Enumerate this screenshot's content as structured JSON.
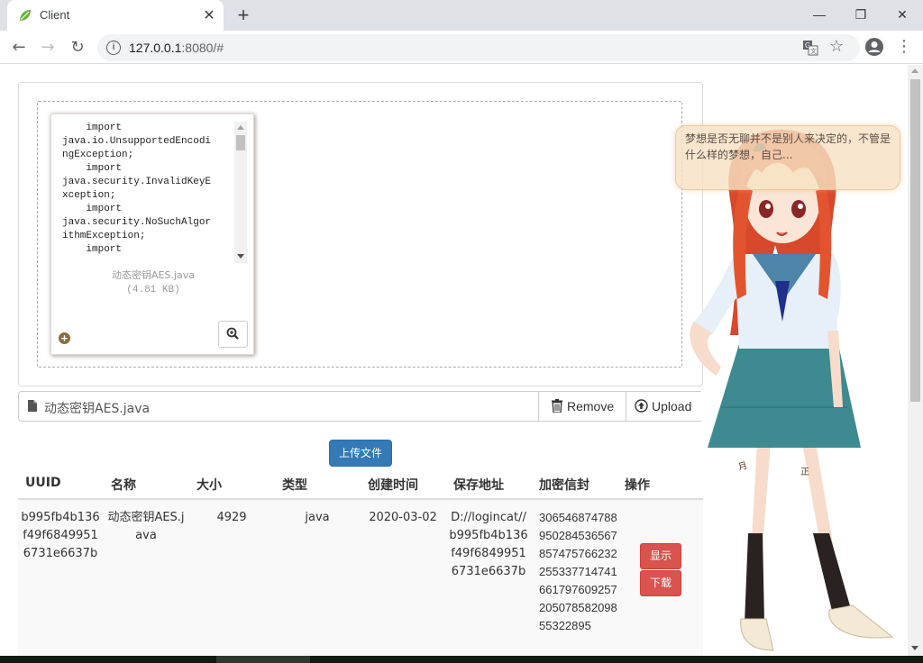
{
  "browser": {
    "tab_title": "Client",
    "url_host": "127.0.0.1",
    "url_rest": ":8080/#",
    "new_tab": "+",
    "close_tab": "✕",
    "window": {
      "minimize": "—",
      "maximize": "❐",
      "close": "✕"
    }
  },
  "preview": {
    "code_lines": [
      "    import",
      "java.io.UnsupportedEncodi",
      "ngException;",
      "    import",
      "java.security.InvalidKeyE",
      "xception;",
      "    import",
      "java.security.NoSuchAlgor",
      "ithmException;",
      "    import"
    ],
    "file_name": "动态密钥AES.java",
    "file_size": "(4.81 KB)"
  },
  "file_input": {
    "selected_file": "动态密钥AES.java",
    "remove_label": "Remove",
    "upload_label": "Upload"
  },
  "submit_label": "上传文件",
  "table": {
    "headers": [
      "UUID",
      "名称",
      "大小",
      "类型",
      "创建时间",
      "保存地址",
      "加密信封",
      "操作"
    ],
    "rows": [
      {
        "uuid": "b995fb4b136f49f68499516731e6637b",
        "name": "动态密钥AES.java",
        "size": "4929",
        "type": "java",
        "created": "2020-03-02",
        "path": "D://logincat//b995fb4b136f49f68499516731e6637b",
        "envelope": "30654687478895028453656785747576623225533771474166179760925720507858209855322895",
        "show_label": "显示",
        "download_label": "下载"
      }
    ]
  },
  "mascot": {
    "speech": "梦想是否无聊并不是别人来决定的，不管是什么样的梦想，自己..."
  },
  "colors": {
    "primary": "#337ab7",
    "danger": "#d9534f",
    "tab_strip": "#dee1e6"
  }
}
